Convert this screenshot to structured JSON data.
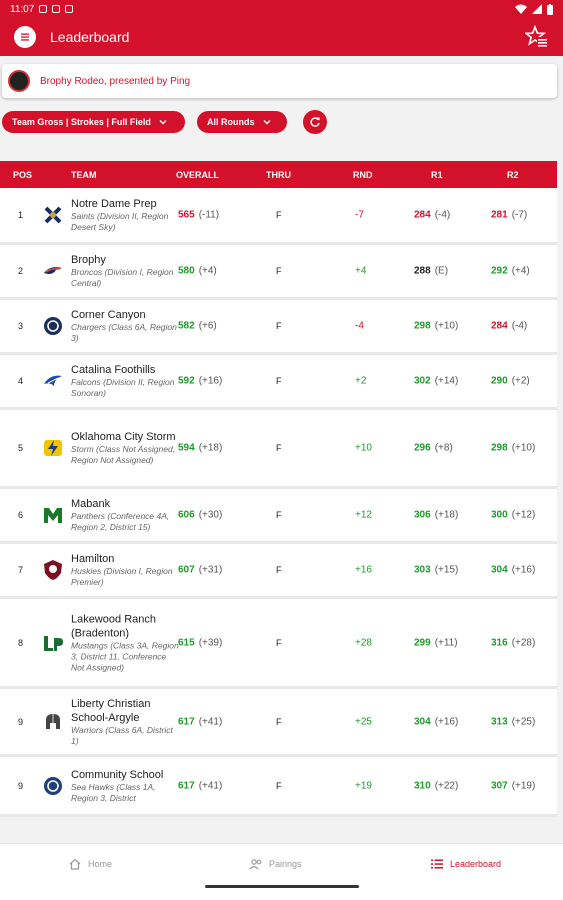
{
  "status": {
    "time": "11:07"
  },
  "appbar": {
    "title": "Leaderboard"
  },
  "event": {
    "name": "Brophy Rodeo, presented by Ping"
  },
  "filters": {
    "scoring": "Team Gross | Strokes | Full Field",
    "rounds": "All Rounds"
  },
  "columns": {
    "pos": "POS",
    "team": "TEAM",
    "overall": "OVERALL",
    "thru": "THRU",
    "rnd": "RND",
    "r1": "R1",
    "r2": "R2"
  },
  "rows": [
    {
      "pos": "1",
      "name": "Notre Dame Prep",
      "sub": "Saints (Division II, Region Desert Sky)",
      "overall": "565",
      "overall_par": "(-11)",
      "thru": "F",
      "rnd": "-7",
      "r1": "284",
      "r1_par": "(-4)",
      "r2": "281",
      "r2_par": "(-7)",
      "logo": "saints-logo"
    },
    {
      "pos": "2",
      "name": "Brophy",
      "sub": "Broncos (Division I, Region Central)",
      "overall": "580",
      "overall_par": "(+4)",
      "thru": "F",
      "rnd": "+4",
      "r1": "288",
      "r1_par": "(E)",
      "r2": "292",
      "r2_par": "(+4)",
      "logo": "broncos-logo"
    },
    {
      "pos": "3",
      "name": "Corner Canyon",
      "sub": "Chargers (Class 6A, Region 3)",
      "overall": "582",
      "overall_par": "(+6)",
      "thru": "F",
      "rnd": "-4",
      "r1": "298",
      "r1_par": "(+10)",
      "r2": "284",
      "r2_par": "(-4)",
      "logo": "chargers-logo"
    },
    {
      "pos": "4",
      "name": "Catalina Foothills",
      "sub": "Falcons (Division II, Region Sonoran)",
      "overall": "592",
      "overall_par": "(+16)",
      "thru": "F",
      "rnd": "+2",
      "r1": "302",
      "r1_par": "(+14)",
      "r2": "290",
      "r2_par": "(+2)",
      "logo": "falcons-logo"
    },
    {
      "pos": "5",
      "name": "Oklahoma City Storm",
      "sub": "Storm (Class Not Assigned, Region Not Assigned)",
      "overall": "594",
      "overall_par": "(+18)",
      "thru": "F",
      "rnd": "+10",
      "r1": "296",
      "r1_par": "(+8)",
      "r2": "298",
      "r2_par": "(+10)",
      "logo": "storm-logo"
    },
    {
      "pos": "6",
      "name": "Mabank",
      "sub": "Panthers (Conference 4A, Region 2, District 15)",
      "overall": "606",
      "overall_par": "(+30)",
      "thru": "F",
      "rnd": "+12",
      "r1": "306",
      "r1_par": "(+18)",
      "r2": "300",
      "r2_par": "(+12)",
      "logo": "panthers-logo"
    },
    {
      "pos": "7",
      "name": "Hamilton",
      "sub": "Huskies (Division I, Region Premier)",
      "overall": "607",
      "overall_par": "(+31)",
      "thru": "F",
      "rnd": "+16",
      "r1": "303",
      "r1_par": "(+15)",
      "r2": "304",
      "r2_par": "(+16)",
      "logo": "huskies-logo"
    },
    {
      "pos": "8",
      "name": "Lakewood Ranch (Bradenton)",
      "sub": "Mustangs (Class 3A, Region 3, District 11, Conference Not Assigned)",
      "overall": "615",
      "overall_par": "(+39)",
      "thru": "F",
      "rnd": "+28",
      "r1": "299",
      "r1_par": "(+11)",
      "r2": "316",
      "r2_par": "(+28)",
      "logo": "mustangs-logo"
    },
    {
      "pos": "9",
      "name": "Liberty Christian School-Argyle",
      "sub": "Warriors (Class 6A, District 1)",
      "overall": "617",
      "overall_par": "(+41)",
      "thru": "F",
      "rnd": "+25",
      "r1": "304",
      "r1_par": "(+16)",
      "r2": "313",
      "r2_par": "(+25)",
      "logo": "warriors-logo"
    },
    {
      "pos": "9",
      "name": "Community School",
      "sub": "Sea Hawks (Class 1A, Region 3, District",
      "overall": "617",
      "overall_par": "(+41)",
      "thru": "F",
      "rnd": "+19",
      "r1": "310",
      "r1_par": "(+22)",
      "r2": "307",
      "r2_par": "(+19)",
      "logo": "seahawks-logo"
    }
  ],
  "nav": {
    "home": "Home",
    "pairings": "Pairings",
    "leaderboard": "Leaderboard"
  },
  "colors": {
    "brand": "#d4112b",
    "under_par": "#d4112b",
    "over_par": "#1e9b2a"
  }
}
